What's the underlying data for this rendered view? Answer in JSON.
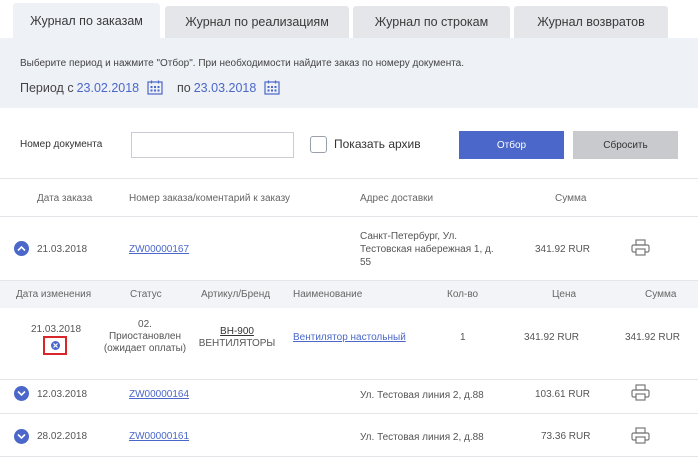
{
  "tabs": [
    {
      "label": "Журнал по заказам"
    },
    {
      "label": "Журнал по реализациям"
    },
    {
      "label": "Журнал по строкам"
    },
    {
      "label": "Журнал возвратов"
    }
  ],
  "period": {
    "hint": "Выберите период и нажмите \"Отбор\". При необходимости найдите заказ по номеру документа.",
    "from_label": "Период с",
    "from_date": "23.02.2018",
    "to_label": "по",
    "to_date": "23.03.2018"
  },
  "filter": {
    "doc_label": "Номер документа",
    "doc_value": "",
    "archive_label": "Показать архив",
    "apply_label": "Отбор",
    "reset_label": "Сбросить"
  },
  "orders_header": {
    "date": "Дата заказа",
    "number": "Номер заказа/коментарий к заказу",
    "address": "Адрес доставки",
    "sum": "Сумма"
  },
  "orders": [
    {
      "date": "21.03.2018",
      "number": "ZW00000167",
      "address_lines": [
        "Санкт-Петербург, Ул.",
        "Тестовская набережная 1, д.",
        "55"
      ],
      "sum": "341.92 RUR"
    },
    {
      "date": "12.03.2018",
      "number": "ZW00000164",
      "address_lines": [
        "Ул. Тестовая линия 2, д.88"
      ],
      "sum": "103.61 RUR"
    },
    {
      "date": "28.02.2018",
      "number": "ZW00000161",
      "address_lines": [
        "Ул. Тестовая линия 2, д.88"
      ],
      "sum": "73.36 RUR"
    }
  ],
  "detail_header": {
    "changed": "Дата изменения",
    "status": "Статус",
    "article": "Артикул/Бренд",
    "name": "Наименование",
    "qty": "Кол-во",
    "price": "Цена",
    "sum": "Сумма"
  },
  "detail_row": {
    "changed": "21.03.2018",
    "status_lines": [
      "02.",
      "Приостановлен",
      "(ожидает оплаты)"
    ],
    "article": "BH-900",
    "brand": "ВЕНТИЛЯТОРЫ",
    "name": "Вентилятор настольный",
    "qty": "1",
    "price": "341.92 RUR",
    "sum": "341.92 RUR"
  },
  "colors": {
    "accent": "#4a67c9",
    "reset": "#c8cacd",
    "panel": "#eef1f6",
    "highlight_border": "#d9262b"
  }
}
